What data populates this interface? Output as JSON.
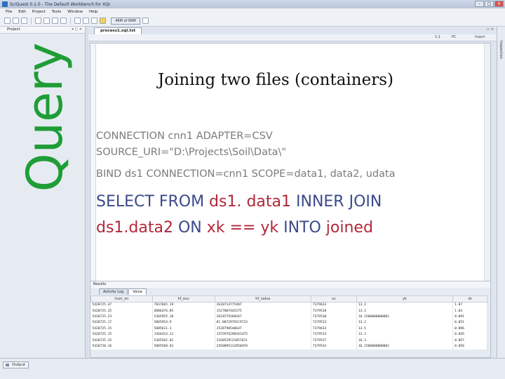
{
  "window": {
    "title": "SciQuest 0.1.0 - The Default Workbench for XQI"
  },
  "menu": [
    "File",
    "Edit",
    "Project",
    "Tools",
    "Window",
    "Help"
  ],
  "toolbar": {
    "memory": "46M of 69M"
  },
  "project_panel": {
    "title": "Project"
  },
  "overlay": {
    "query_label": "Query"
  },
  "editor": {
    "tab": "process1.xql.txt",
    "status": {
      "position": "1:1",
      "mode": "PC",
      "insert": "Insert"
    }
  },
  "slide": {
    "title": "Joining two files (containers)",
    "lines": [
      "CONNECTION cnn1 ADAPTER=CSV",
      "SOURCE_URI=\"D:\\Projects\\Soil\\Data\\\"",
      "BIND ds1 CONNECTION=cnn1 SCOPE=data1, data2, udata"
    ],
    "select_line1": {
      "kw1": "SELECT FROM ",
      "id1": "ds1. data1",
      "kw2": " INNER JOIN"
    },
    "select_line2": {
      "id1": "ds1.data2",
      "kw1": " ON ",
      "id2": "xk == yk",
      "kw2": " INTO ",
      "id3": "joined"
    }
  },
  "results": {
    "title": "Results",
    "tabs": [
      "Activity Log",
      "Value"
    ],
    "columns": [
      "hum_on",
      "hf_esu",
      "hf_value",
      "uc",
      "yk",
      "vk"
    ],
    "rows": [
      [
        "5420725.47",
        "7837665.19",
        "2620714775487",
        "7379633",
        "13.2",
        "1.07"
      ],
      [
        "5420725.35",
        "6886476.85",
        "1527807445275",
        "7379538",
        "13.2",
        "1.03"
      ],
      [
        "5420725.23",
        "5365955.10",
        "2624579160447",
        "7379538",
        "16.1500000000001",
        "0.091"
      ],
      [
        "5420725.17",
        "5065954.9",
        "01.00729792C9723",
        "7379523",
        "13.2",
        "0.051"
      ],
      [
        "5420725.15",
        "5085611.1",
        "2528790540647",
        "7379633",
        "13.5",
        "0.096"
      ],
      [
        "5420725.15",
        "1364433.11",
        "1255976298341475",
        "7379533",
        "13.1",
        "0.045"
      ],
      [
        "5420725.15",
        "5365562.01",
        "2160529C21857621",
        "7379537",
        "16.3",
        "0.057"
      ],
      [
        "5420720.16",
        "5065560.01",
        "2450095212850459",
        "7379533",
        "16.1500000000001",
        "0.056"
      ]
    ]
  },
  "bottom": {
    "output": "Output"
  },
  "right_rail": {
    "label": "Inspection"
  }
}
